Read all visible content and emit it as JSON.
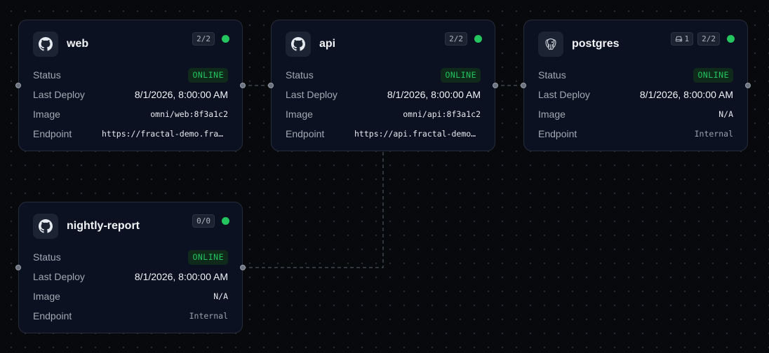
{
  "labels": {
    "status": "Status",
    "last_deploy": "Last Deploy",
    "image": "Image",
    "endpoint": "Endpoint"
  },
  "colors": {
    "online": "#22c55e",
    "card_bg": "#0b1120",
    "canvas_bg": "#08090c"
  },
  "services": [
    {
      "name": "web",
      "icon": "github-icon",
      "replicas": "2/2",
      "status": "ONLINE",
      "last_deploy": "8/1/2026, 8:00:00 AM",
      "image": "omni/web:8f3a1c2",
      "endpoint": "https://fractal-demo.fractal.dev"
    },
    {
      "name": "api",
      "icon": "github-icon",
      "replicas": "2/2",
      "status": "ONLINE",
      "last_deploy": "8/1/2026, 8:00:00 AM",
      "image": "omni/api:8f3a1c2",
      "endpoint": "https://api.fractal-demo.fractal.dev"
    },
    {
      "name": "postgres",
      "icon": "postgres-icon",
      "volumes": "1",
      "replicas": "2/2",
      "status": "ONLINE",
      "last_deploy": "8/1/2026, 8:00:00 AM",
      "image": "N/A",
      "endpoint": "Internal"
    },
    {
      "name": "nightly-report",
      "icon": "github-icon",
      "replicas": "0/0",
      "status": "ONLINE",
      "last_deploy": "8/1/2026, 8:00:00 AM",
      "image": "N/A",
      "endpoint": "Internal"
    }
  ]
}
